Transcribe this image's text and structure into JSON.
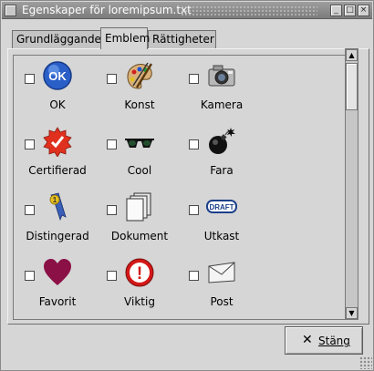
{
  "window": {
    "title": "Egenskaper för loremipsum.txt",
    "minimize_glyph": "_",
    "maximize_glyph": "□",
    "close_glyph": "×"
  },
  "tabs": [
    {
      "label": "Grundläggande",
      "active": false
    },
    {
      "label": "Emblem",
      "active": true
    },
    {
      "label": "Rättigheter",
      "active": false
    }
  ],
  "emblems": [
    {
      "label": "OK",
      "icon": "ok-icon",
      "checked": false
    },
    {
      "label": "Konst",
      "icon": "art-palette-icon",
      "checked": false
    },
    {
      "label": "Kamera",
      "icon": "camera-icon",
      "checked": false
    },
    {
      "label": "Certifierad",
      "icon": "certified-seal-icon",
      "checked": false
    },
    {
      "label": "Cool",
      "icon": "sunglasses-icon",
      "checked": false
    },
    {
      "label": "Fara",
      "icon": "bomb-icon",
      "checked": false
    },
    {
      "label": "Distingerad",
      "icon": "ribbon-icon",
      "checked": false
    },
    {
      "label": "Dokument",
      "icon": "documents-icon",
      "checked": false
    },
    {
      "label": "Utkast",
      "icon": "draft-stamp-icon",
      "checked": false
    },
    {
      "label": "Favorit",
      "icon": "heart-icon",
      "checked": false
    },
    {
      "label": "Viktig",
      "icon": "important-icon",
      "checked": false
    },
    {
      "label": "Post",
      "icon": "envelope-icon",
      "checked": false
    }
  ],
  "icon_text": {
    "ok": "OK",
    "draft": "DRAFT",
    "ribbon_number": "1",
    "important": "!"
  },
  "scrollbar": {
    "up_glyph": "▲",
    "down_glyph": "▼"
  },
  "footer": {
    "close_label": "Stäng",
    "close_glyph": "✕"
  },
  "colors": {
    "window_bg": "#d6d6d6",
    "titlebar": "#8a8a8a",
    "ok_blue": "#2a5fc8",
    "seal_red": "#e0301e",
    "heart": "#8a1046",
    "important_red": "#d41818"
  }
}
